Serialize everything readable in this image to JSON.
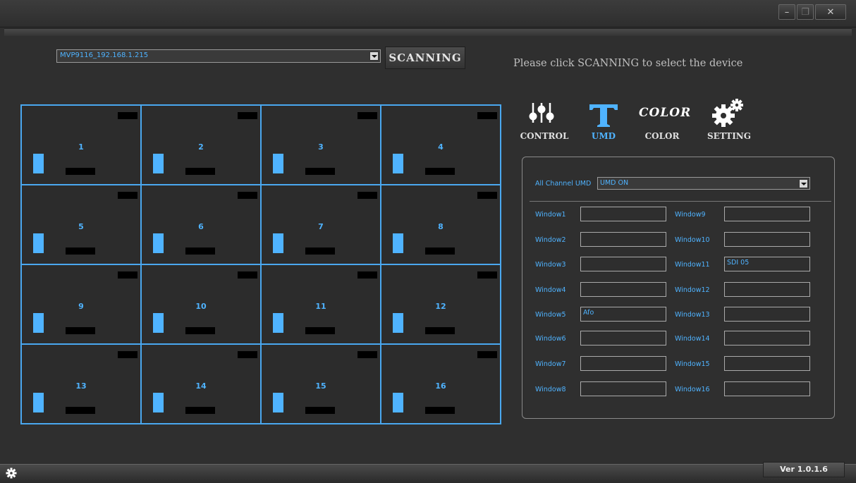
{
  "window": {
    "minimize": "–",
    "maximize": "❐",
    "close": "✕"
  },
  "device_select": {
    "value": "MVP9116_192.168.1.215"
  },
  "scan_button": "SCANNING",
  "hint": "Please click SCANNING to select the device",
  "grid": {
    "cells": [
      "1",
      "2",
      "3",
      "4",
      "5",
      "6",
      "7",
      "8",
      "9",
      "10",
      "11",
      "12",
      "13",
      "14",
      "15",
      "16"
    ]
  },
  "tabs": [
    {
      "label": "CONTROL",
      "icon": "sliders-icon",
      "active": false
    },
    {
      "label": "UMD",
      "icon": "text-t-icon",
      "active": true
    },
    {
      "label": "COLOR",
      "icon": "color-text-icon",
      "icon_text": "COLOR",
      "active": false
    },
    {
      "label": "SETTING",
      "icon": "gears-icon",
      "active": false
    }
  ],
  "umd": {
    "all_label": "All Channel UMD",
    "all_value": "UMD ON",
    "windows_left": [
      {
        "label": "Window1",
        "value": ""
      },
      {
        "label": "Window2",
        "value": ""
      },
      {
        "label": "Window3",
        "value": ""
      },
      {
        "label": "Window4",
        "value": ""
      },
      {
        "label": "Window5",
        "value": "Afo"
      },
      {
        "label": "Window6",
        "value": ""
      },
      {
        "label": "Window7",
        "value": ""
      },
      {
        "label": "Window8",
        "value": ""
      }
    ],
    "windows_right": [
      {
        "label": "Window9",
        "value": ""
      },
      {
        "label": "Window10",
        "value": ""
      },
      {
        "label": "Window11",
        "value": "SDI 05"
      },
      {
        "label": "Window12",
        "value": ""
      },
      {
        "label": "Window13",
        "value": ""
      },
      {
        "label": "Window14",
        "value": ""
      },
      {
        "label": "Window15",
        "value": ""
      },
      {
        "label": "Window16",
        "value": ""
      }
    ]
  },
  "version": "Ver 1.0.1.6",
  "colors": {
    "accent": "#4fb3ff",
    "background": "#2f2f2f"
  }
}
